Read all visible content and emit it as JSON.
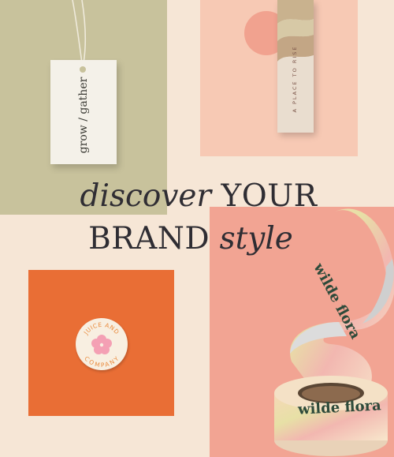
{
  "hang_tag": {
    "text": "grow / gather"
  },
  "box": {
    "text": "A PLACE TO RISE"
  },
  "headline": {
    "line1_italic": "discover",
    "line1_caps": "YOUR",
    "line2_caps": "BRAND",
    "line2_italic": "style"
  },
  "sticker": {
    "top_text": "JUICE AND",
    "bottom_text": "COMPANY"
  },
  "tape": {
    "label_top": "wilde flora",
    "label_bottom": "wilde flora"
  },
  "colors": {
    "background": "#f6e6d6",
    "olive": "#c8c29c",
    "peach": "#f7c9b4",
    "salmon": "#f2a493",
    "orange": "#e96e35",
    "text": "#2f2d33"
  }
}
